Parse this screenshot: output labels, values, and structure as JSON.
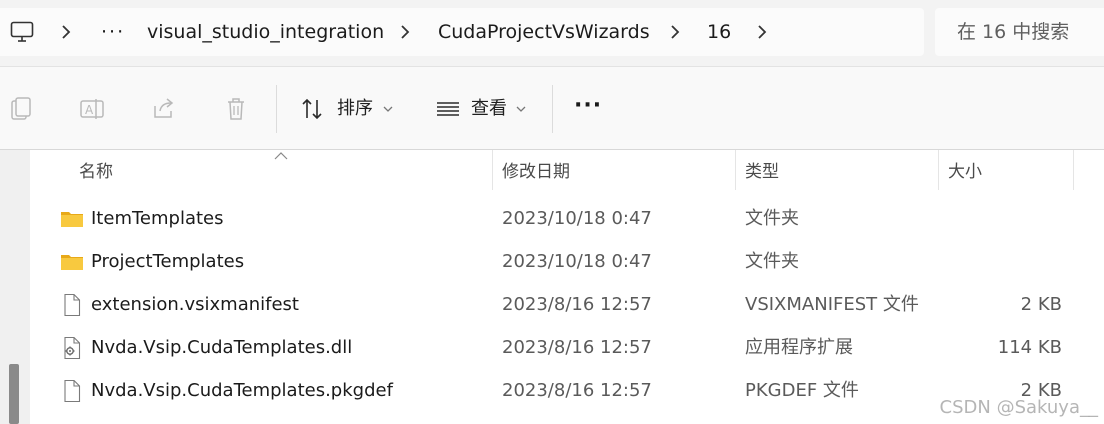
{
  "address_bar": {
    "breadcrumb": [
      "visual_studio_integration",
      "CudaProjectVsWizards",
      "16"
    ],
    "overflow": "···",
    "search_placeholder": "在 16 中搜索"
  },
  "command_bar": {
    "sort_label": "排序",
    "view_label": "查看",
    "more_label": "···"
  },
  "columns": {
    "name": "名称",
    "date": "修改日期",
    "type": "类型",
    "size": "大小"
  },
  "files": [
    {
      "name": "ItemTemplates",
      "date": "2023/10/18 0:47",
      "type": "文件夹",
      "size": "",
      "icon": "folder-icon"
    },
    {
      "name": "ProjectTemplates",
      "date": "2023/10/18 0:47",
      "type": "文件夹",
      "size": "",
      "icon": "folder-icon"
    },
    {
      "name": "extension.vsixmanifest",
      "date": "2023/8/16 12:57",
      "type": "VSIXMANIFEST 文件",
      "size": "2 KB",
      "icon": "file-icon"
    },
    {
      "name": "Nvda.Vsip.CudaTemplates.dll",
      "date": "2023/8/16 12:57",
      "type": "应用程序扩展",
      "size": "114 KB",
      "icon": "dll-icon"
    },
    {
      "name": "Nvda.Vsip.CudaTemplates.pkgdef",
      "date": "2023/8/16 12:57",
      "type": "PKGDEF 文件",
      "size": "2 KB",
      "icon": "file-icon"
    }
  ],
  "watermark": "CSDN @Sakuya__",
  "colors": {
    "folder": "#f8c93f",
    "accent": "#0067c0"
  }
}
